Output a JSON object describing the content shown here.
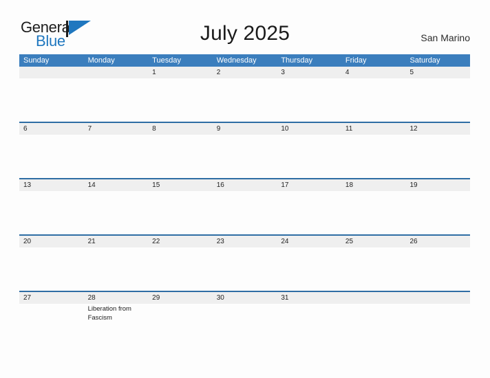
{
  "brand": {
    "word_one": "General",
    "word_two": "Blue",
    "flag_icon": "flag-triangle-icon",
    "accent_color": "#1f77bf"
  },
  "header": {
    "title": "July 2025",
    "location": "San Marino"
  },
  "theme": {
    "header_blue": "#3b7ebd",
    "rule_blue": "#2e6da4",
    "date_band_gray": "#efefef",
    "page_background": "#fdfdfd"
  },
  "calendar": {
    "day_headers": [
      "Sunday",
      "Monday",
      "Tuesday",
      "Wednesday",
      "Thursday",
      "Friday",
      "Saturday"
    ],
    "weeks": [
      {
        "ruled": false,
        "days": [
          {
            "date": "",
            "events": []
          },
          {
            "date": "",
            "events": []
          },
          {
            "date": "1",
            "events": []
          },
          {
            "date": "2",
            "events": []
          },
          {
            "date": "3",
            "events": []
          },
          {
            "date": "4",
            "events": []
          },
          {
            "date": "5",
            "events": []
          }
        ]
      },
      {
        "ruled": true,
        "days": [
          {
            "date": "6",
            "events": []
          },
          {
            "date": "7",
            "events": []
          },
          {
            "date": "8",
            "events": []
          },
          {
            "date": "9",
            "events": []
          },
          {
            "date": "10",
            "events": []
          },
          {
            "date": "11",
            "events": []
          },
          {
            "date": "12",
            "events": []
          }
        ]
      },
      {
        "ruled": true,
        "days": [
          {
            "date": "13",
            "events": []
          },
          {
            "date": "14",
            "events": []
          },
          {
            "date": "15",
            "events": []
          },
          {
            "date": "16",
            "events": []
          },
          {
            "date": "17",
            "events": []
          },
          {
            "date": "18",
            "events": []
          },
          {
            "date": "19",
            "events": []
          }
        ]
      },
      {
        "ruled": true,
        "days": [
          {
            "date": "20",
            "events": []
          },
          {
            "date": "21",
            "events": []
          },
          {
            "date": "22",
            "events": []
          },
          {
            "date": "23",
            "events": []
          },
          {
            "date": "24",
            "events": []
          },
          {
            "date": "25",
            "events": []
          },
          {
            "date": "26",
            "events": []
          }
        ]
      },
      {
        "ruled": true,
        "days": [
          {
            "date": "27",
            "events": []
          },
          {
            "date": "28",
            "events": [
              "Liberation from Fascism"
            ]
          },
          {
            "date": "29",
            "events": []
          },
          {
            "date": "30",
            "events": []
          },
          {
            "date": "31",
            "events": []
          },
          {
            "date": "",
            "events": []
          },
          {
            "date": "",
            "events": []
          }
        ]
      }
    ]
  }
}
